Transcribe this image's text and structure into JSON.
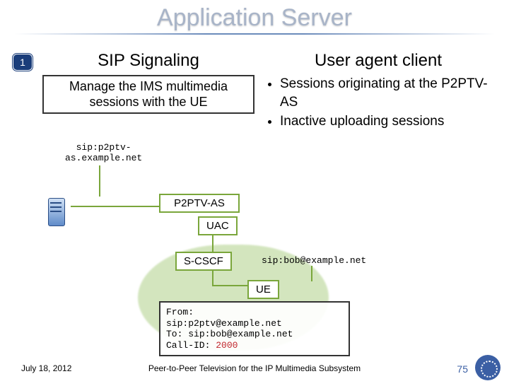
{
  "title": "Application Server",
  "badge": "1",
  "left": {
    "heading": "SIP Signaling",
    "desc": "Manage the IMS multimedia sessions with the UE",
    "sip_line1": "sip:p2ptv-",
    "sip_line2": "as.example.net"
  },
  "right": {
    "heading": "User agent client",
    "bullets": [
      "Sessions originating at the P2PTV-AS",
      "Inactive uploading sessions"
    ]
  },
  "diagram": {
    "p2ptv": "P2PTV-AS",
    "uac": "UAC",
    "scscf": "S-CSCF",
    "ue": "UE",
    "bob": "sip:bob@example.net",
    "msg": {
      "from_lbl": "From:",
      "from_val": "sip:p2ptv@example.net",
      "to_lbl": "To: ",
      "to_val": "sip:bob@example.net",
      "cid_lbl": "Call-ID: ",
      "cid_val": "2000"
    }
  },
  "footer": {
    "date": "July 18, 2012",
    "caption": "Peer-to-Peer Television for the IP Multimedia Subsystem",
    "page": "75"
  }
}
